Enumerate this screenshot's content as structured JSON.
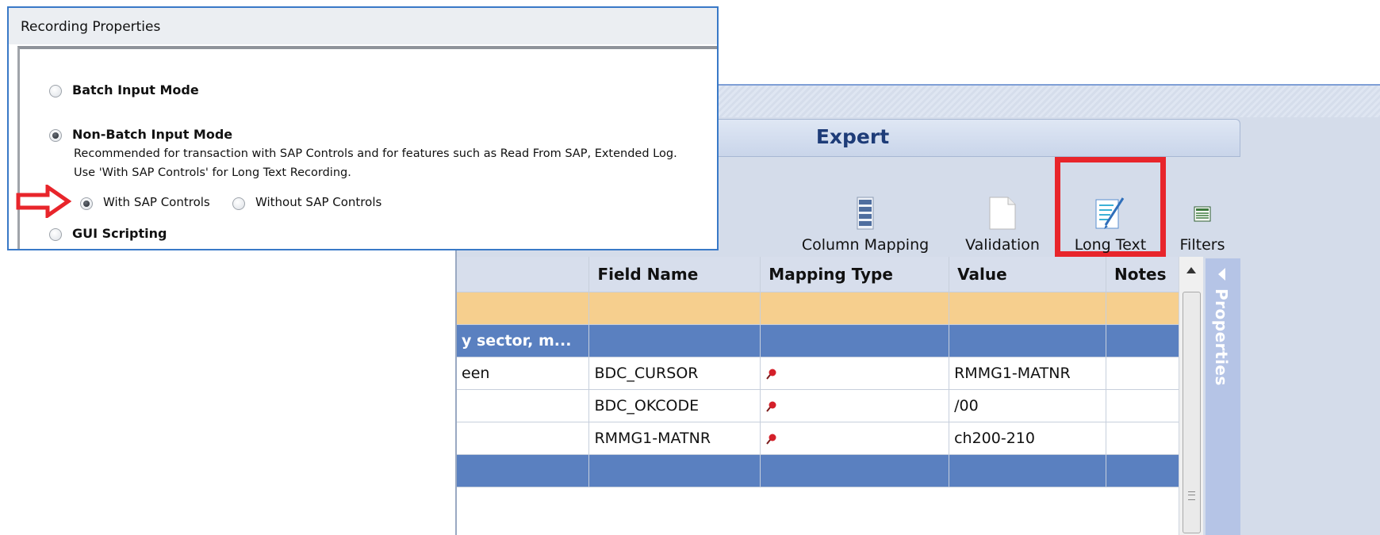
{
  "dialog": {
    "title": "Recording Properties",
    "options": [
      {
        "label": "Batch Input Mode",
        "checked": false
      },
      {
        "label": "Non-Batch Input Mode",
        "checked": true
      },
      {
        "label": "GUI Scripting",
        "checked": false
      }
    ],
    "description_line1": "Recommended for transaction with SAP Controls and for features such as Read From SAP, Extended Log.",
    "description_line2": "Use 'With SAP Controls' for Long Text Recording.",
    "sub_options": [
      {
        "label": "With SAP Controls",
        "checked": true
      },
      {
        "label": "Without SAP Controls",
        "checked": false
      }
    ],
    "arrow_color": "#e8252b"
  },
  "expert": {
    "title": "Expert",
    "ribbon": [
      {
        "label": "Column Mapping",
        "icon": "column-mapping-icon"
      },
      {
        "label": "Validation",
        "icon": "validation-icon"
      },
      {
        "label": "Long Text",
        "icon": "long-text-icon",
        "highlighted": true
      },
      {
        "label": "Filters",
        "icon": "filters-icon"
      }
    ],
    "grid": {
      "columns": [
        "",
        "Field Name",
        "Mapping Type",
        "Value",
        "Notes"
      ],
      "rows": [
        {
          "type": "empty",
          "cells": [
            "",
            "",
            "",
            "",
            ""
          ]
        },
        {
          "type": "group",
          "cells": [
            "y sector, m...",
            "",
            "",
            "",
            ""
          ]
        },
        {
          "type": "data",
          "cells": [
            "een",
            "BDC_CURSOR",
            "pin",
            "RMMG1-MATNR",
            ""
          ]
        },
        {
          "type": "data",
          "cells": [
            "",
            "BDC_OKCODE",
            "pin",
            "/00",
            ""
          ]
        },
        {
          "type": "data",
          "cells": [
            "",
            "RMMG1-MATNR",
            "pin",
            "ch200-210",
            ""
          ]
        },
        {
          "type": "group",
          "cells": [
            "",
            "",
            "",
            "",
            ""
          ]
        }
      ]
    },
    "side_panel_label": "Properties",
    "highlight_color": "#e8252b"
  }
}
